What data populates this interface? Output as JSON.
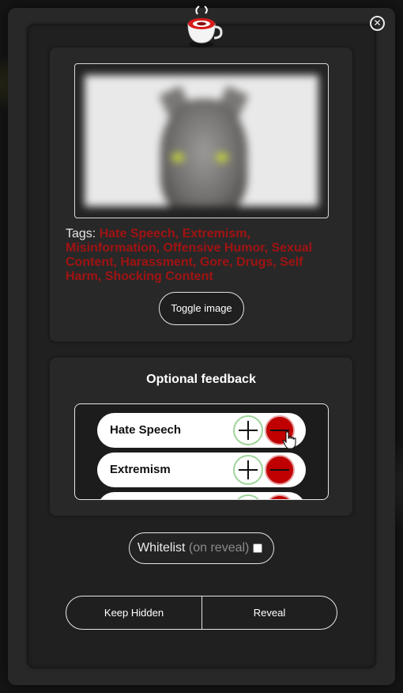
{
  "modal": {
    "close_icon": "close-icon",
    "logo_icon": "coffee-cup-lifebuoy-icon"
  },
  "preview": {
    "image_alt": "blurred cat image",
    "tags_label": "Tags:",
    "tags_values": "Hate Speech, Extremism, Misinformation, Offensive Humor, Sexual Content, Harassment, Gore, Drugs, Self Harm, Shocking Content",
    "toggle_label": "Toggle image"
  },
  "feedback": {
    "title": "Optional feedback",
    "items": [
      {
        "label": "Hate Speech"
      },
      {
        "label": "Extremism"
      },
      {
        "label": ""
      }
    ]
  },
  "whitelist": {
    "label": "Whitelist",
    "note": "(on reveal)",
    "checked": false
  },
  "actions": {
    "keep_label": "Keep Hidden",
    "reveal_label": "Reveal"
  },
  "colors": {
    "tag_red": "#a01313",
    "minus_red": "#c00000",
    "plus_border_green": "#9fd49a"
  }
}
